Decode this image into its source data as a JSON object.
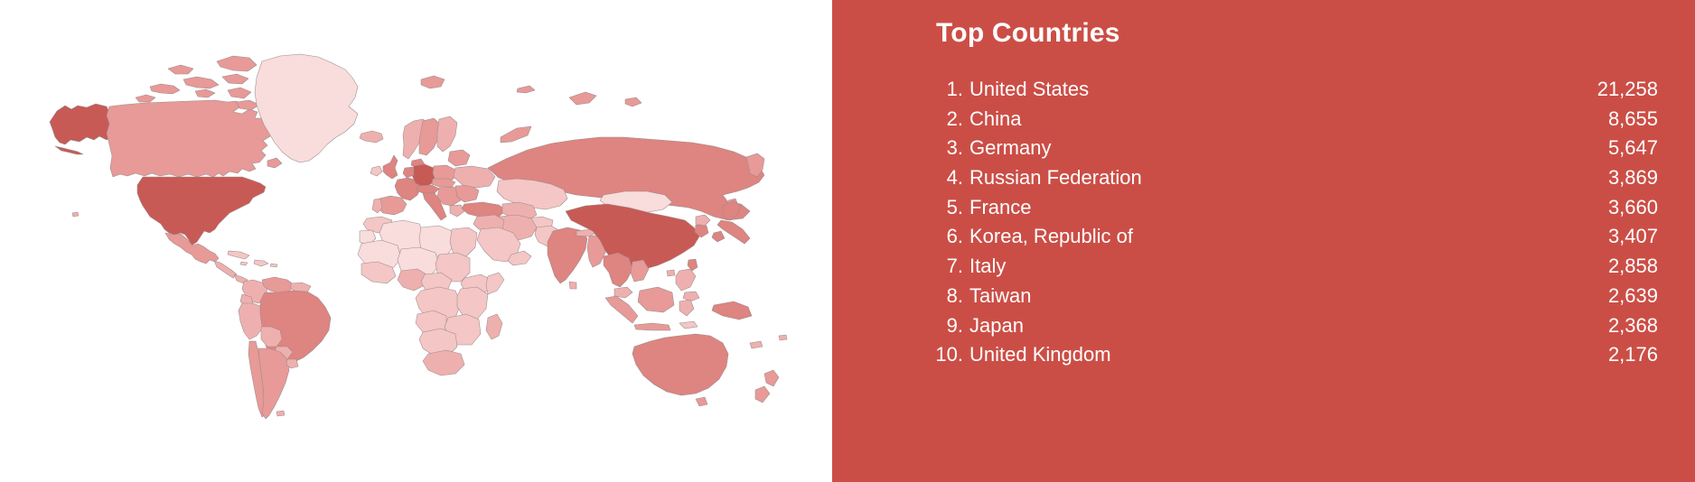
{
  "panel": {
    "title": "Top Countries",
    "background_color": "#cb4e46",
    "text_color": "#ffffff"
  },
  "map": {
    "background_color": "#ffffff",
    "border_color": "#9b8b8b",
    "type": "choropleth-world-map",
    "scale_colors": {
      "level_0": "#fdf0f0",
      "level_1": "#f9dcdc",
      "level_2": "#f4c6c5",
      "level_3": "#eeb0ae",
      "level_4": "#e79a97",
      "level_5": "#de8481",
      "level_6": "#d46f6b",
      "level_7": "#c85a55"
    }
  },
  "top_countries": [
    {
      "rank": "1.",
      "name": "United States",
      "value": "21,258"
    },
    {
      "rank": "2.",
      "name": "China",
      "value": "8,655"
    },
    {
      "rank": "3.",
      "name": "Germany",
      "value": "5,647"
    },
    {
      "rank": "4.",
      "name": "Russian Federation",
      "value": "3,869"
    },
    {
      "rank": "5.",
      "name": "France",
      "value": "3,660"
    },
    {
      "rank": "6.",
      "name": "Korea, Republic of",
      "value": "3,407"
    },
    {
      "rank": "7.",
      "name": "Italy",
      "value": "2,858"
    },
    {
      "rank": "8.",
      "name": "Taiwan",
      "value": "2,639"
    },
    {
      "rank": "9.",
      "name": "Japan",
      "value": "2,368"
    },
    {
      "rank": "10.",
      "name": "United Kingdom",
      "value": "2,176"
    }
  ],
  "chart_data": {
    "type": "bar",
    "title": "Top Countries",
    "xlabel": "",
    "ylabel": "",
    "categories": [
      "United States",
      "China",
      "Germany",
      "Russian Federation",
      "France",
      "Korea, Republic of",
      "Italy",
      "Taiwan",
      "Japan",
      "United Kingdom"
    ],
    "values": [
      21258,
      8655,
      5647,
      3869,
      3660,
      3407,
      2858,
      2639,
      2368,
      2176
    ],
    "ylim": [
      0,
      21258
    ],
    "grid": false,
    "legend": "none",
    "map_shading": {
      "United States": 7,
      "China": 6,
      "Germany": 7,
      "Russian Federation": 5,
      "France": 5,
      "Korea, Republic of": 5,
      "Italy": 5,
      "Taiwan": 5,
      "Japan": 5,
      "United Kingdom": 5,
      "Canada": 4,
      "Greenland": 1,
      "Brazil": 5,
      "Australia": 5,
      "India": 5,
      "Mexico": 4,
      "Kazakhstan": 3,
      "Mongolia": 2,
      "Africa_general": 2
    }
  }
}
